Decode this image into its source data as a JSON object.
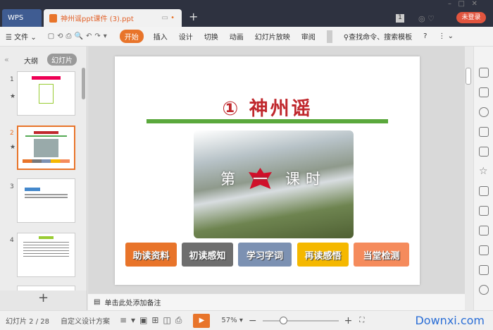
{
  "app": {
    "wps_label": "WPS",
    "doc_tab": "神州谣ppt课件 (3).ppt",
    "badge": "1",
    "login": "未登录"
  },
  "toolbar": {
    "file": "文件",
    "tabs": [
      "开始",
      "插入",
      "设计",
      "切换",
      "动画",
      "幻灯片放映",
      "审阅"
    ],
    "search": "查找命令、搜索模板",
    "help": "?"
  },
  "left": {
    "tabs": [
      "大纲",
      "幻灯片"
    ],
    "slides": [
      "1",
      "2",
      "3",
      "4"
    ],
    "add": "+"
  },
  "slide": {
    "title": "① 神州谣",
    "subtitle_pre": "第",
    "subtitle_mid": "一",
    "subtitle_post": "课时",
    "steps": [
      {
        "label": "助读资料",
        "color": "#e8742a"
      },
      {
        "label": "初读感知",
        "color": "#6e6e6e"
      },
      {
        "label": "学习字词",
        "color": "#7c91b2"
      },
      {
        "label": "再读感悟",
        "color": "#f5b800"
      },
      {
        "label": "当堂检测",
        "color": "#f58b5c"
      }
    ]
  },
  "notes": {
    "placeholder": "单击此处添加备注"
  },
  "status": {
    "slide_counter": "幻灯片 2 / 28",
    "design": "自定义设计方案",
    "zoom": "57%",
    "zoom_level": 0.57
  },
  "watermark": "Downxi.com"
}
